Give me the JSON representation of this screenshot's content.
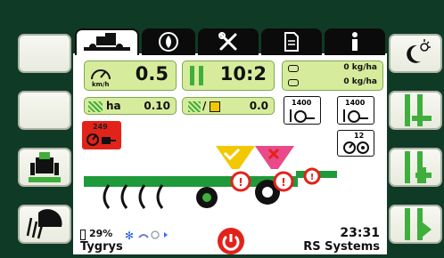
{
  "tabs": [
    {
      "name": "tab-machine",
      "icon": "tractor-icon",
      "active": true
    },
    {
      "name": "tab-seeding",
      "icon": "seed-cycle-icon",
      "active": false
    },
    {
      "name": "tab-service",
      "icon": "wrench-icon",
      "active": false
    },
    {
      "name": "tab-document",
      "icon": "document-icon",
      "active": false
    },
    {
      "name": "tab-info",
      "icon": "info-icon",
      "active": false
    }
  ],
  "left_buttons": [
    {
      "name": "left-button-1",
      "icon": "blank"
    },
    {
      "name": "left-button-2",
      "icon": "blank"
    },
    {
      "name": "hitch-button",
      "icon": "tractor-hitch-icon"
    },
    {
      "name": "work-light-button",
      "icon": "work-light-icon"
    }
  ],
  "right_buttons": [
    {
      "name": "day-night-button",
      "icon": "day-night-icon"
    },
    {
      "name": "tramline-minus-button",
      "icon": "tramline-minus-icon"
    },
    {
      "name": "tramline-plus-button",
      "icon": "tramline-plus-icon"
    },
    {
      "name": "tramline-play-button",
      "icon": "tramline-play-icon"
    }
  ],
  "speed": {
    "value": "0.5",
    "unit": "km/h"
  },
  "tramline": {
    "value": "10:2"
  },
  "rates": [
    {
      "label": "0 kg/ha"
    },
    {
      "label": "0 kg/ha"
    }
  ],
  "area": {
    "label": "ha",
    "value": "0.10"
  },
  "partial": {
    "value": "0.0"
  },
  "hopper_rpm": [
    {
      "value": "1400"
    },
    {
      "value": "1400"
    }
  ],
  "fan": {
    "value": "12"
  },
  "alarm": {
    "value": "249"
  },
  "status": {
    "battery": "29%",
    "name": "Tygrys",
    "time": "23:31",
    "brand": "RS Systems"
  },
  "colors": {
    "accent_green": "#18a046",
    "tile_green": "#d6ec9c",
    "machine_green": "#1f9a3a",
    "alarm_red": "#e2231a",
    "hopper_yellow": "#f2c800",
    "hopper_pink": "#e84a8a"
  }
}
